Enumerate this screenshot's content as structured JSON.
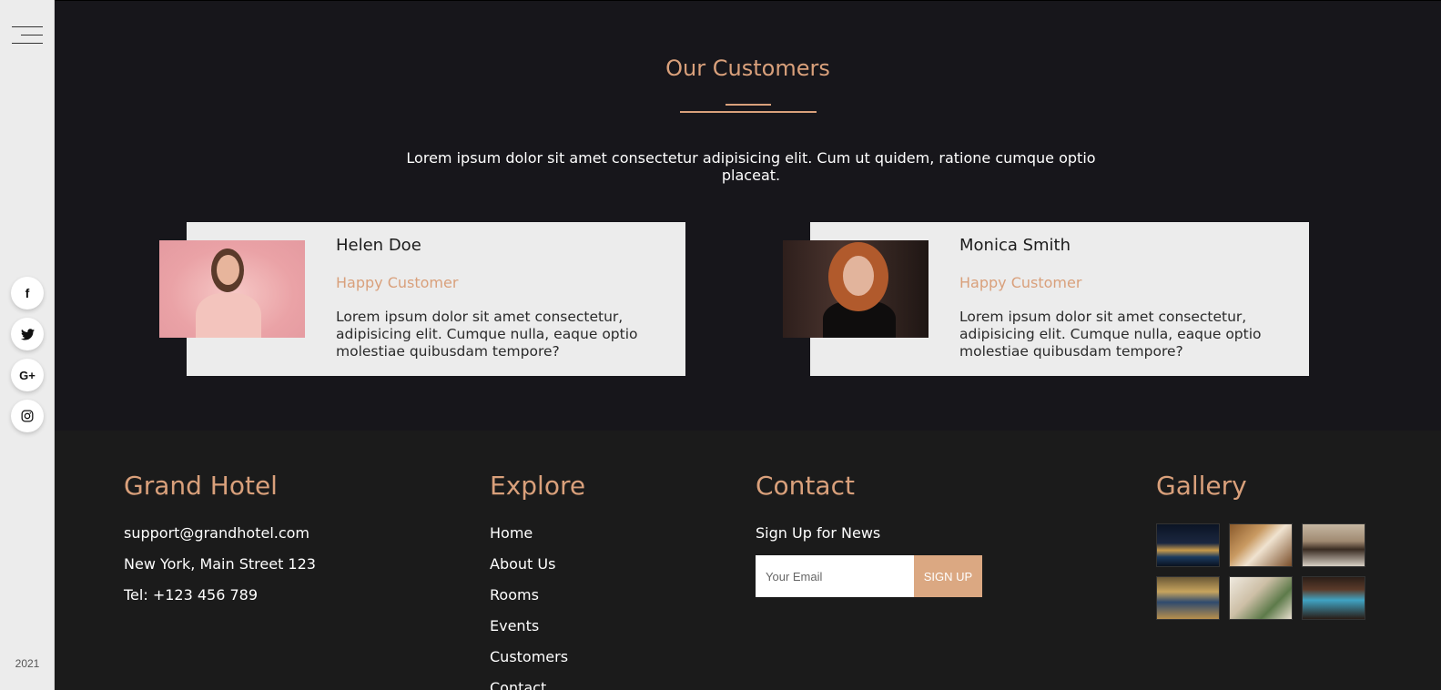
{
  "sidebar": {
    "menu_icon": "hamburger-menu-icon",
    "social": [
      {
        "name": "facebook",
        "icon": "facebook-icon",
        "glyph": "f"
      },
      {
        "name": "twitter",
        "icon": "twitter-icon",
        "glyph": ""
      },
      {
        "name": "google-plus",
        "icon": "google-plus-icon",
        "glyph": "G+"
      },
      {
        "name": "instagram",
        "icon": "instagram-icon",
        "glyph": ""
      }
    ],
    "year": "2021"
  },
  "customers": {
    "title": "Our Customers",
    "description": "Lorem ipsum dolor sit amet consectetur adipisicing elit. Cum ut quidem, ratione cumque optio placeat.",
    "cards": [
      {
        "name": "Helen Doe",
        "role": "Happy Customer",
        "text": "Lorem ipsum dolor sit amet consectetur, adipisicing elit. Cumque nulla, eaque optio molestiae quibusdam tempore?"
      },
      {
        "name": "Monica Smith",
        "role": "Happy Customer",
        "text": "Lorem ipsum dolor sit amet consectetur, adipisicing elit. Cumque nulla, eaque optio molestiae quibusdam tempore?"
      }
    ]
  },
  "footer": {
    "grand": {
      "title": "Grand Hotel",
      "email": "support@grandhotel.com",
      "address": "New York, Main Street 123",
      "phone": "Tel: +123 456 789"
    },
    "explore": {
      "title": "Explore",
      "links": [
        "Home",
        "About Us",
        "Rooms",
        "Events",
        "Customers",
        "Contact"
      ]
    },
    "contact": {
      "title": "Contact",
      "signup_label": "Sign Up for News",
      "email_placeholder": "Your Email",
      "button_label": "SIGN UP"
    },
    "gallery": {
      "title": "Gallery"
    }
  },
  "colors": {
    "accent": "#d9a07b",
    "dark_bg": "#17161b",
    "footer_bg": "#1b1b1b",
    "sidebar_bg": "#ececec",
    "card_bg": "#ececec"
  }
}
